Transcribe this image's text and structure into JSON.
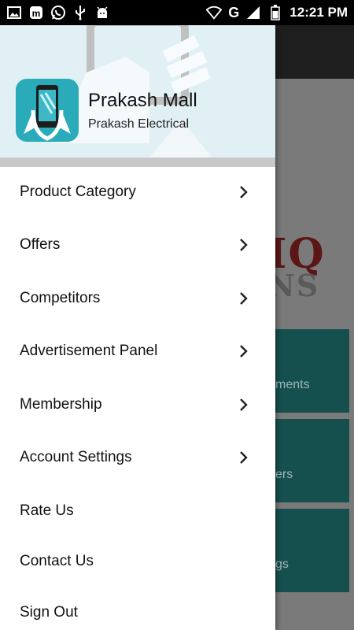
{
  "status_bar": {
    "time": "12:21 PM",
    "network_label": "G",
    "icons": [
      "image-icon",
      "messenger-m-icon",
      "whatsapp-icon",
      "usb-icon",
      "android-icon",
      "wifi-icon",
      "signal-icon",
      "battery-icon"
    ]
  },
  "background": {
    "logo_line1": "IQ",
    "logo_line2": "NS",
    "tiles": [
      "ments",
      "ers",
      "gs"
    ]
  },
  "drawer": {
    "app_name": "Prakash Mall",
    "app_subtitle": "Prakash Electrical",
    "menu": [
      {
        "label": "Product Category",
        "has_chevron": true
      },
      {
        "label": "Offers",
        "has_chevron": true
      },
      {
        "label": "Competitors",
        "has_chevron": true
      },
      {
        "label": "Advertisement Panel",
        "has_chevron": true
      },
      {
        "label": "Membership",
        "has_chevron": true
      },
      {
        "label": "Account Settings",
        "has_chevron": true
      },
      {
        "label": "Rate Us",
        "has_chevron": false
      },
      {
        "label": "Contact Us",
        "has_chevron": false
      },
      {
        "label": "Sign Out",
        "has_chevron": false
      }
    ]
  },
  "colors": {
    "header_bg": "#e1f0f4",
    "logo_bg": "#2aabb9",
    "tile_bg": "#15504f",
    "accent_dark": "#5c1616"
  }
}
